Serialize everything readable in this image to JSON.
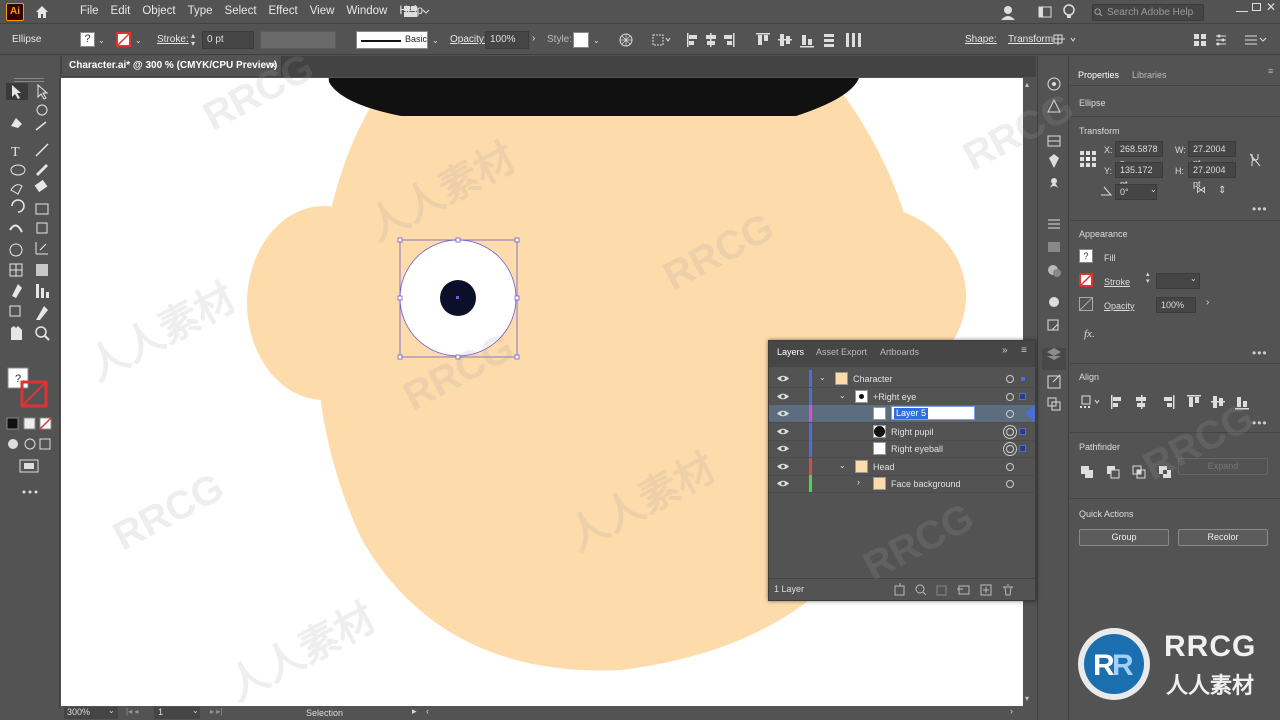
{
  "app": {
    "logo": "Ai",
    "menus": [
      "File",
      "Edit",
      "Object",
      "Type",
      "Select",
      "Effect",
      "View",
      "Window",
      "Help"
    ],
    "search_placeholder": "Search Adobe Help"
  },
  "control": {
    "object_type": "Ellipse",
    "stroke_label": "Stroke:",
    "stroke_value": "0 pt",
    "brush_label": "Basic",
    "opacity_label": "Opacity:",
    "opacity_value": "100%",
    "style_label": "Style:",
    "shape_label": "Shape:",
    "transform_label": "Transform"
  },
  "document": {
    "tab_title": "Character.ai* @ 300 % (CMYK/CPU Preview)",
    "close": "×"
  },
  "status": {
    "zoom": "300%",
    "artboard": "1",
    "tool": "Selection"
  },
  "properties": {
    "tabs": [
      "Properties",
      "Libraries"
    ],
    "object": "Ellipse",
    "transform_title": "Transform",
    "x_label": "X:",
    "x": "268.5878 p",
    "y_label": "Y:",
    "y": "135.172 pt",
    "w_label": "W:",
    "w": "27.2004 pt",
    "h_label": "H:",
    "h": "27.2004 pt",
    "angle": "0°",
    "appearance_title": "Appearance",
    "fill_label": "Fill",
    "stroke_label": "Stroke",
    "opacity_label": "Opacity",
    "opacity": "100%",
    "fx": "fx.",
    "align_title": "Align",
    "pathfinder_title": "Pathfinder",
    "expand": "Expand",
    "quick_actions_title": "Quick Actions",
    "group_button": "Group",
    "recolor_button": "Recolor"
  },
  "layers_panel": {
    "tabs": [
      "Layers",
      "Asset Export",
      "Artboards"
    ],
    "rows": [
      {
        "name": "Character",
        "color": "#4a6fd8",
        "indent": 0
      },
      {
        "name": "+Right eye",
        "color": "#4a6fd8",
        "indent": 1
      },
      {
        "name": "Layer 5",
        "color": "#e04ad8",
        "indent": 2
      },
      {
        "name": "Right pupil",
        "color": "#4a6fd8",
        "indent": 2
      },
      {
        "name": "Right eyeball",
        "color": "#4a6fd8",
        "indent": 2
      },
      {
        "name": "Head",
        "color": "#d84a4a",
        "indent": 0
      },
      {
        "name": "Face background",
        "color": "#4ad84a",
        "indent": 1
      }
    ],
    "footer": "1 Layer"
  },
  "colors": {
    "skin": "#fedbab",
    "hat": "#111111",
    "selection": "#6b5bd6"
  },
  "watermark": {
    "text1": "RRCG",
    "text2": "人人素材"
  }
}
